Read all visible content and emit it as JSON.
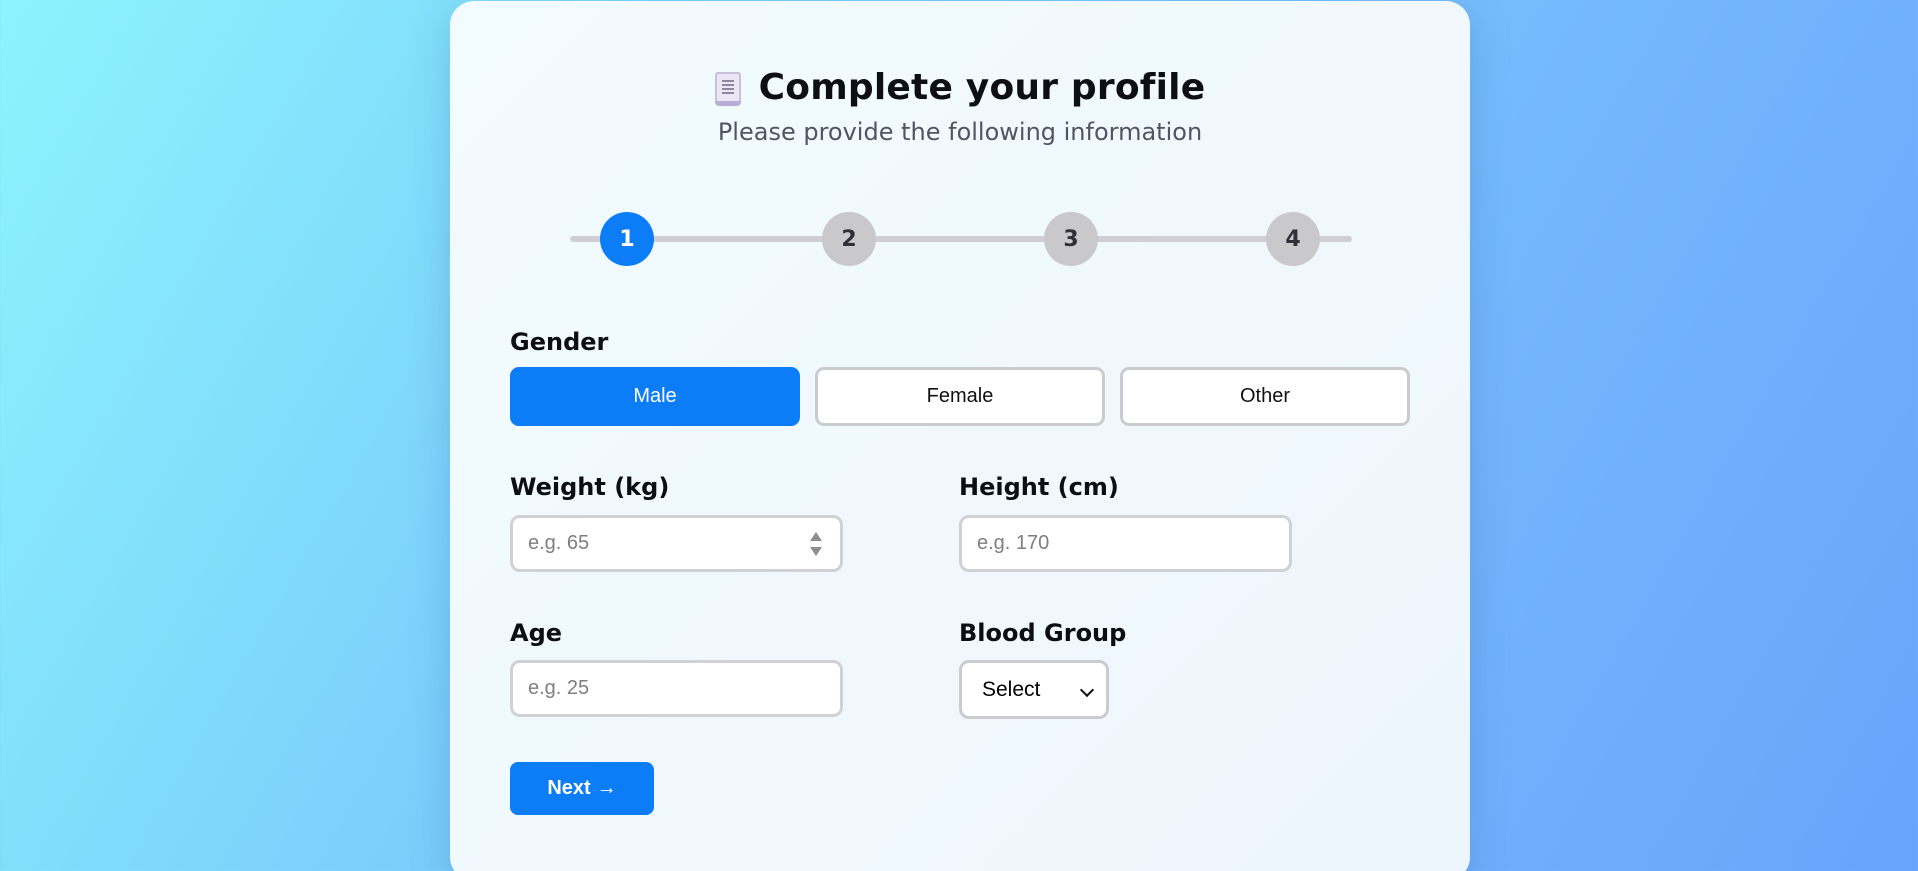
{
  "header": {
    "title": "Complete your profile",
    "subtitle": "Please provide the following information"
  },
  "stepper": {
    "steps": [
      "1",
      "2",
      "3",
      "4"
    ],
    "active_step": 1
  },
  "form": {
    "gender": {
      "label": "Gender",
      "options": [
        "Male",
        "Female",
        "Other"
      ],
      "selected": "Male"
    },
    "weight": {
      "label": "Weight (kg)",
      "placeholder": "e.g. 65",
      "value": ""
    },
    "height": {
      "label": "Height (cm)",
      "placeholder": "e.g. 170",
      "value": ""
    },
    "age": {
      "label": "Age",
      "placeholder": "e.g. 25",
      "value": ""
    },
    "blood_group": {
      "label": "Blood Group",
      "selected": "Select"
    }
  },
  "actions": {
    "next_label": "Next",
    "next_arrow": "→"
  },
  "colors": {
    "accent": "#0d7cf7",
    "inactive_step": "#c9c9cc",
    "card_background": "#f2fbfe"
  },
  "icons": {
    "title_icon": "document-icon"
  }
}
